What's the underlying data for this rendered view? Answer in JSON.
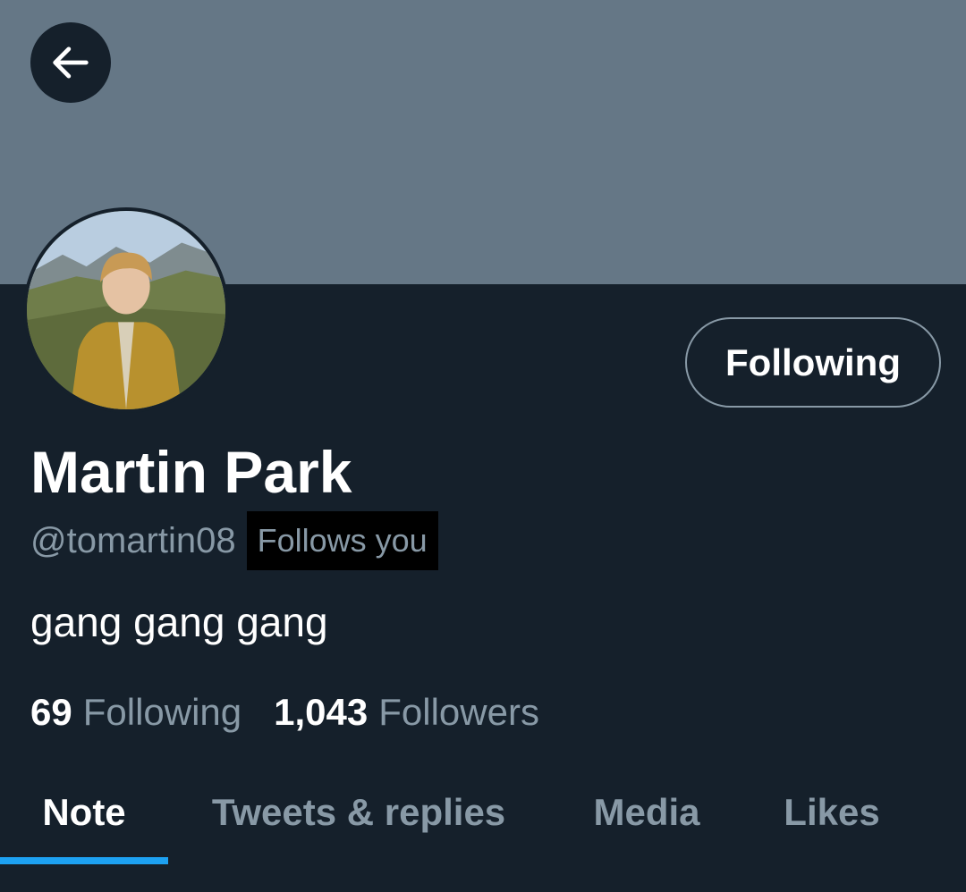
{
  "header": {
    "back_icon": "arrow-left-icon",
    "banner_color": "#657786"
  },
  "profile": {
    "display_name": "Martin Park",
    "handle": "@tomartin08",
    "follows_you_badge": "Follows you",
    "bio": "gang gang gang",
    "follow_button_label": "Following",
    "stats": {
      "following_count": "69",
      "following_label": "Following",
      "followers_count": "1,043",
      "followers_label": "Followers"
    }
  },
  "tabs": [
    {
      "label": "Note",
      "active": true
    },
    {
      "label": "Tweets & replies",
      "active": false
    },
    {
      "label": "Media",
      "active": false
    },
    {
      "label": "Likes",
      "active": false
    }
  ],
  "colors": {
    "background": "#15202b",
    "accent": "#1da1f2",
    "secondary_text": "#8899a6"
  }
}
